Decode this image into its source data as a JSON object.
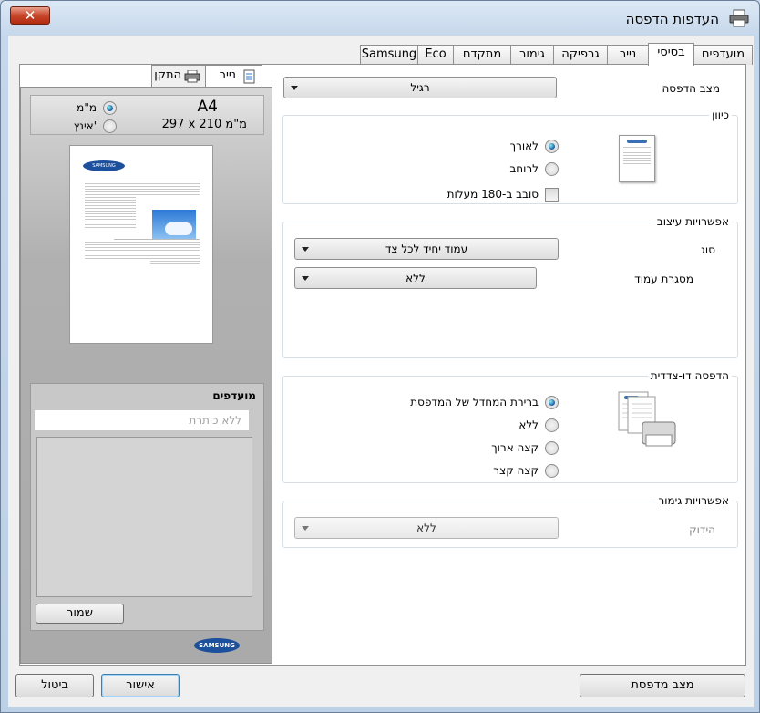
{
  "window": {
    "title": "העדפות הדפסה",
    "close_label": "✕"
  },
  "tabs": [
    {
      "label": "מועדפים"
    },
    {
      "label": "בסיסי"
    },
    {
      "label": "נייר"
    },
    {
      "label": "גרפיקה"
    },
    {
      "label": "גימור"
    },
    {
      "label": "מתקדם"
    },
    {
      "label": "Eco"
    },
    {
      "label": "Samsung"
    }
  ],
  "preview": {
    "tab_paper": "נייר",
    "tab_device": "התקן",
    "paper_name": "A4",
    "paper_dims": "297 x 210 מ\"מ",
    "unit_mm": "מ\"מ",
    "unit_inch": "אינץ'",
    "favorites_title": "מועדפים",
    "favorites_placeholder": "ללא כותרת",
    "save_label": "שמור",
    "brand": "SAMSUNG",
    "doc_brand": "SAMSUNG"
  },
  "basic": {
    "print_mode_label": "מצב הדפסה",
    "print_mode_value": "רגיל",
    "orientation": {
      "title": "כיוון",
      "portrait": "לאורך",
      "landscape": "לרוחב",
      "rotate": "סובב ב-180 מעלות"
    },
    "layout": {
      "title": "אפשרויות עיצוב",
      "type_label": "סוג",
      "type_value": "עמוד יחיד לכל צד",
      "border_label": "מסגרת עמוד",
      "border_value": "ללא"
    },
    "duplex": {
      "title": "הדפסה דו-צדדית",
      "default": "ברירת המחדל של המדפסת",
      "none": "ללא",
      "long_edge": "קצה ארוך",
      "short_edge": "קצה קצר"
    },
    "finishing": {
      "title": "אפשרויות גימור",
      "staple_label": "הידוק",
      "staple_value": "ללא"
    }
  },
  "footer": {
    "printer_status": "מצב מדפסת",
    "ok": "אישור",
    "cancel": "ביטול"
  }
}
